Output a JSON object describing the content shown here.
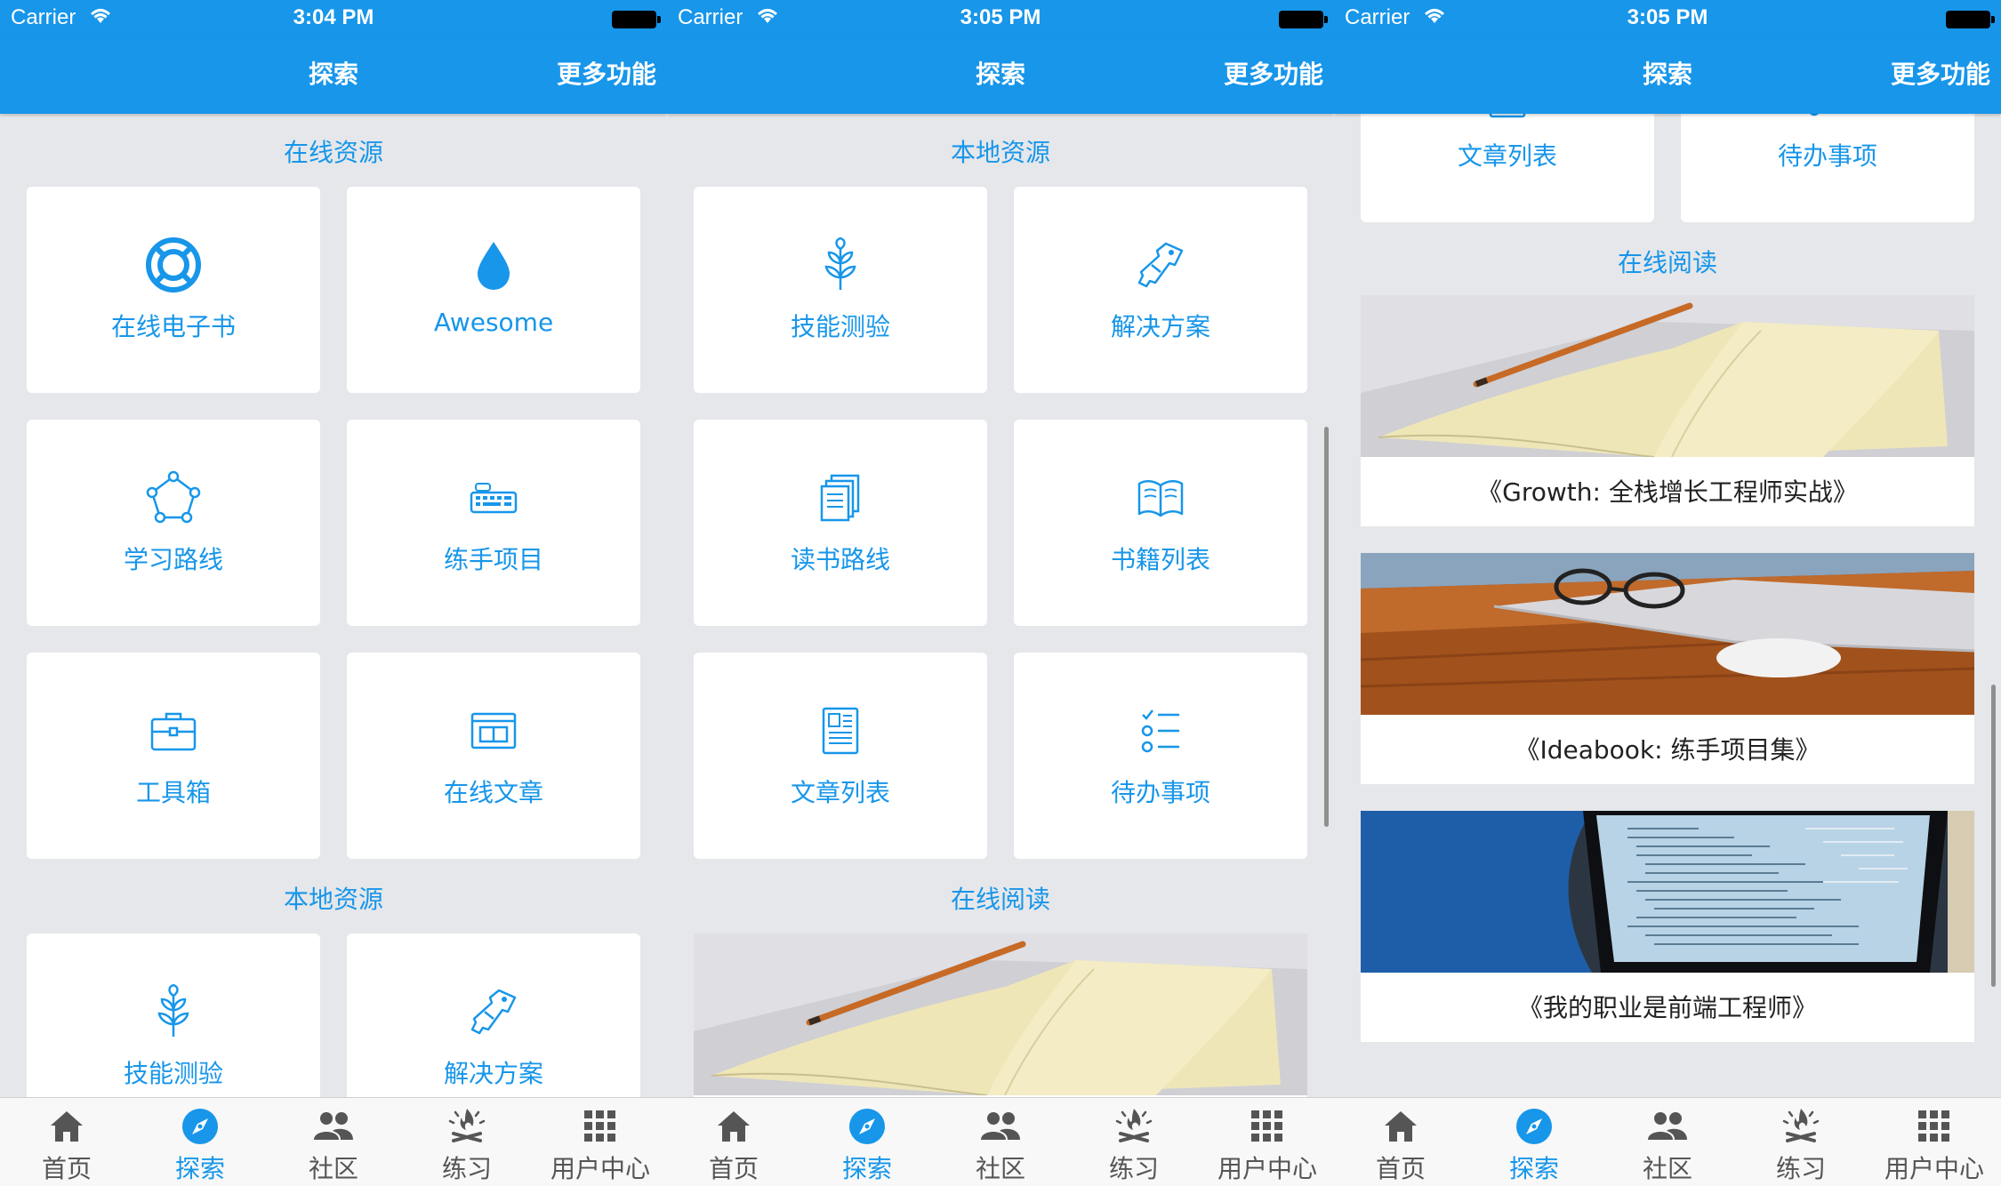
{
  "frames": [
    {
      "status": {
        "carrier": "Carrier",
        "time": "3:04 PM"
      }
    },
    {
      "status": {
        "carrier": "Carrier",
        "time": "3:05 PM"
      }
    },
    {
      "status": {
        "carrier": "Carrier",
        "time": "3:05 PM"
      }
    }
  ],
  "navbar": {
    "explore": "探索",
    "more": "更多功能"
  },
  "sections": {
    "online_resources": "在线资源",
    "local_resources": "本地资源",
    "online_reading": "在线阅读"
  },
  "online_items": [
    {
      "label": "在线电子书",
      "icon": "lifebuoy-icon"
    },
    {
      "label": "Awesome",
      "icon": "drop-icon"
    },
    {
      "label": "学习路线",
      "icon": "route-nodes-icon"
    },
    {
      "label": "练手项目",
      "icon": "keyboard-icon"
    },
    {
      "label": "工具箱",
      "icon": "toolbox-icon"
    },
    {
      "label": "在线文章",
      "icon": "browser-article-icon"
    }
  ],
  "local_items": [
    {
      "label": "技能测验",
      "icon": "sprout-icon"
    },
    {
      "label": "解决方案",
      "icon": "keys-icon"
    },
    {
      "label": "读书路线",
      "icon": "book-stack-icon"
    },
    {
      "label": "书籍列表",
      "icon": "open-book-icon"
    },
    {
      "label": "文章列表",
      "icon": "document-icon"
    },
    {
      "label": "待办事项",
      "icon": "checklist-icon"
    }
  ],
  "books": [
    {
      "title": "《Growth: 全栈增长工程师实战》",
      "image": "notebook-pencil-photo"
    },
    {
      "title": "《Ideabook: 练手项目集》",
      "image": "laptop-glasses-photo"
    },
    {
      "title": "《我的职业是前端工程师》",
      "image": "coding-screen-photo"
    }
  ],
  "tabbar": [
    "首页",
    "探索",
    "社区",
    "练习",
    "用户中心"
  ],
  "colors": {
    "accent": "#1796ea",
    "background": "#e6e7ea",
    "card": "#ffffff"
  }
}
